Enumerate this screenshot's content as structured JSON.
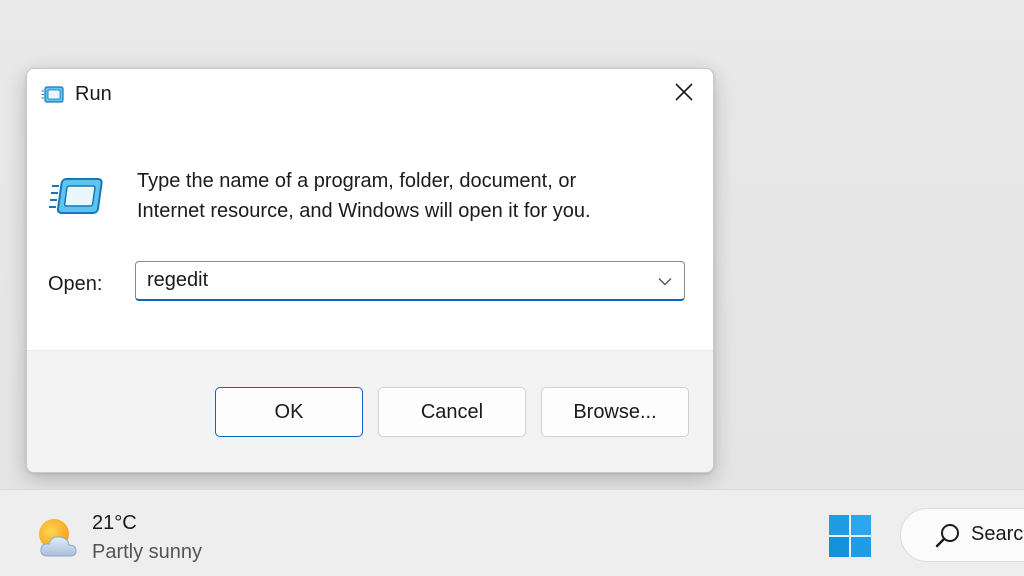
{
  "dialog": {
    "title": "Run",
    "description_line1": "Type the name of a program, folder, document, or",
    "description_line2": "Internet resource, and Windows will open it for you.",
    "open_label": "Open:",
    "open_value": "regedit",
    "buttons": {
      "ok": "OK",
      "cancel": "Cancel",
      "browse": "Browse..."
    },
    "icons": {
      "title": "run-app-icon",
      "close": "close-icon",
      "large": "run-app-icon",
      "dropdown": "chevron-down-icon"
    }
  },
  "taskbar": {
    "weather": {
      "temperature": "21°C",
      "condition": "Partly sunny",
      "icon": "partly-sunny-icon"
    },
    "start_icon": "windows-logo-icon",
    "search": {
      "label": "Search",
      "icon": "search-icon"
    }
  },
  "colors": {
    "accent": "#0a66c2",
    "dialog_footer": "#f3f3f3",
    "taskbar": "#eeeeee",
    "windows_logo": "#1e9de6"
  }
}
